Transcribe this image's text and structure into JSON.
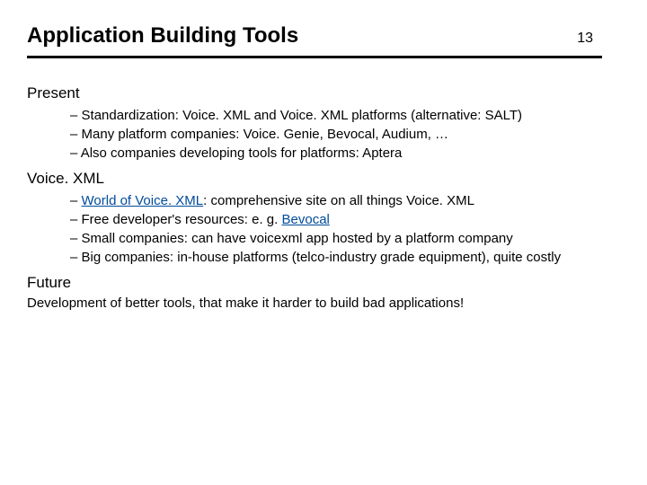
{
  "header": {
    "title": "Application Building Tools",
    "slide_number": "13"
  },
  "sections": {
    "present": {
      "heading": "Present",
      "items": [
        {
          "pre": "Standardization: Voice. XML and Voice. XML platforms (alternative: SALT)"
        },
        {
          "pre": "Many platform companies: Voice. Genie, Bevocal, Audium, …"
        },
        {
          "pre": "Also companies developing tools for platforms: Aptera"
        }
      ]
    },
    "voicexml": {
      "heading": "Voice. XML",
      "items": [
        {
          "link": "World of Voice. XML",
          "post": ": comprehensive site on all things Voice. XML"
        },
        {
          "pre": "Free developer's resources: e. g. ",
          "link": "Bevocal"
        },
        {
          "pre": "Small companies: can have voicexml app hosted by a platform company"
        },
        {
          "pre": "Big companies: in-house platforms (telco-industry grade equipment), quite costly"
        }
      ]
    },
    "future": {
      "heading": "Future",
      "text": "Development of better tools, that make it harder to build bad applications!"
    }
  }
}
